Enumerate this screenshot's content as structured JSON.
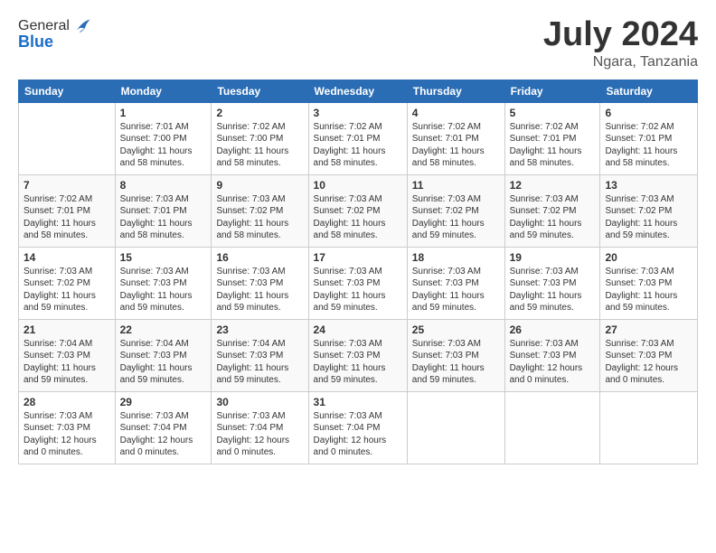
{
  "header": {
    "logo_general": "General",
    "logo_blue": "Blue",
    "title": "July 2024",
    "location": "Ngara, Tanzania"
  },
  "days_of_week": [
    "Sunday",
    "Monday",
    "Tuesday",
    "Wednesday",
    "Thursday",
    "Friday",
    "Saturday"
  ],
  "weeks": [
    [
      {
        "day": "",
        "sunrise": "",
        "sunset": "",
        "daylight": ""
      },
      {
        "day": "1",
        "sunrise": "7:01 AM",
        "sunset": "7:00 PM",
        "daylight": "11 hours and 58 minutes."
      },
      {
        "day": "2",
        "sunrise": "7:02 AM",
        "sunset": "7:00 PM",
        "daylight": "11 hours and 58 minutes."
      },
      {
        "day": "3",
        "sunrise": "7:02 AM",
        "sunset": "7:01 PM",
        "daylight": "11 hours and 58 minutes."
      },
      {
        "day": "4",
        "sunrise": "7:02 AM",
        "sunset": "7:01 PM",
        "daylight": "11 hours and 58 minutes."
      },
      {
        "day": "5",
        "sunrise": "7:02 AM",
        "sunset": "7:01 PM",
        "daylight": "11 hours and 58 minutes."
      },
      {
        "day": "6",
        "sunrise": "7:02 AM",
        "sunset": "7:01 PM",
        "daylight": "11 hours and 58 minutes."
      }
    ],
    [
      {
        "day": "7",
        "sunrise": "7:02 AM",
        "sunset": "7:01 PM",
        "daylight": "11 hours and 58 minutes."
      },
      {
        "day": "8",
        "sunrise": "7:03 AM",
        "sunset": "7:01 PM",
        "daylight": "11 hours and 58 minutes."
      },
      {
        "day": "9",
        "sunrise": "7:03 AM",
        "sunset": "7:02 PM",
        "daylight": "11 hours and 58 minutes."
      },
      {
        "day": "10",
        "sunrise": "7:03 AM",
        "sunset": "7:02 PM",
        "daylight": "11 hours and 58 minutes."
      },
      {
        "day": "11",
        "sunrise": "7:03 AM",
        "sunset": "7:02 PM",
        "daylight": "11 hours and 59 minutes."
      },
      {
        "day": "12",
        "sunrise": "7:03 AM",
        "sunset": "7:02 PM",
        "daylight": "11 hours and 59 minutes."
      },
      {
        "day": "13",
        "sunrise": "7:03 AM",
        "sunset": "7:02 PM",
        "daylight": "11 hours and 59 minutes."
      }
    ],
    [
      {
        "day": "14",
        "sunrise": "7:03 AM",
        "sunset": "7:02 PM",
        "daylight": "11 hours and 59 minutes."
      },
      {
        "day": "15",
        "sunrise": "7:03 AM",
        "sunset": "7:03 PM",
        "daylight": "11 hours and 59 minutes."
      },
      {
        "day": "16",
        "sunrise": "7:03 AM",
        "sunset": "7:03 PM",
        "daylight": "11 hours and 59 minutes."
      },
      {
        "day": "17",
        "sunrise": "7:03 AM",
        "sunset": "7:03 PM",
        "daylight": "11 hours and 59 minutes."
      },
      {
        "day": "18",
        "sunrise": "7:03 AM",
        "sunset": "7:03 PM",
        "daylight": "11 hours and 59 minutes."
      },
      {
        "day": "19",
        "sunrise": "7:03 AM",
        "sunset": "7:03 PM",
        "daylight": "11 hours and 59 minutes."
      },
      {
        "day": "20",
        "sunrise": "7:03 AM",
        "sunset": "7:03 PM",
        "daylight": "11 hours and 59 minutes."
      }
    ],
    [
      {
        "day": "21",
        "sunrise": "7:04 AM",
        "sunset": "7:03 PM",
        "daylight": "11 hours and 59 minutes."
      },
      {
        "day": "22",
        "sunrise": "7:04 AM",
        "sunset": "7:03 PM",
        "daylight": "11 hours and 59 minutes."
      },
      {
        "day": "23",
        "sunrise": "7:04 AM",
        "sunset": "7:03 PM",
        "daylight": "11 hours and 59 minutes."
      },
      {
        "day": "24",
        "sunrise": "7:03 AM",
        "sunset": "7:03 PM",
        "daylight": "11 hours and 59 minutes."
      },
      {
        "day": "25",
        "sunrise": "7:03 AM",
        "sunset": "7:03 PM",
        "daylight": "11 hours and 59 minutes."
      },
      {
        "day": "26",
        "sunrise": "7:03 AM",
        "sunset": "7:03 PM",
        "daylight": "12 hours and 0 minutes."
      },
      {
        "day": "27",
        "sunrise": "7:03 AM",
        "sunset": "7:03 PM",
        "daylight": "12 hours and 0 minutes."
      }
    ],
    [
      {
        "day": "28",
        "sunrise": "7:03 AM",
        "sunset": "7:03 PM",
        "daylight": "12 hours and 0 minutes."
      },
      {
        "day": "29",
        "sunrise": "7:03 AM",
        "sunset": "7:04 PM",
        "daylight": "12 hours and 0 minutes."
      },
      {
        "day": "30",
        "sunrise": "7:03 AM",
        "sunset": "7:04 PM",
        "daylight": "12 hours and 0 minutes."
      },
      {
        "day": "31",
        "sunrise": "7:03 AM",
        "sunset": "7:04 PM",
        "daylight": "12 hours and 0 minutes."
      },
      {
        "day": "",
        "sunrise": "",
        "sunset": "",
        "daylight": ""
      },
      {
        "day": "",
        "sunrise": "",
        "sunset": "",
        "daylight": ""
      },
      {
        "day": "",
        "sunrise": "",
        "sunset": "",
        "daylight": ""
      }
    ]
  ]
}
